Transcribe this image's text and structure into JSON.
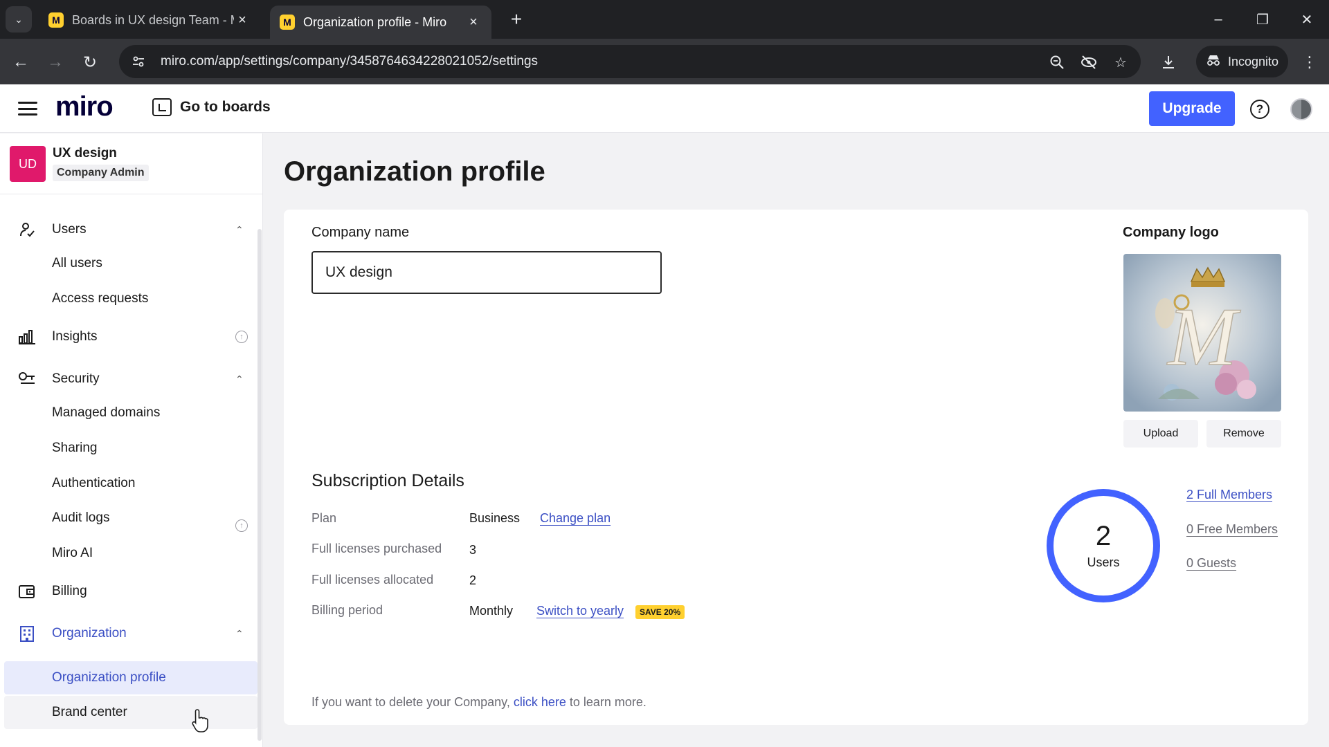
{
  "browser": {
    "tabs": [
      {
        "title": "Boards in UX design Team - Miro",
        "favicon": "miro-favicon"
      },
      {
        "title": "Organization profile - Miro",
        "favicon": "miro-favicon"
      }
    ],
    "url": "miro.com/app/settings/company/3458764634228021052/settings",
    "incognito_label": "Incognito",
    "favicon_letter": "M"
  },
  "header": {
    "logo": "miro",
    "go_to_boards": "Go to boards",
    "upgrade": "Upgrade",
    "help_symbol": "?"
  },
  "sidebar": {
    "org_initials": "UD",
    "org_name": "UX design",
    "org_role": "Company Admin",
    "users": {
      "label": "Users",
      "items": [
        "All users",
        "Access requests"
      ]
    },
    "insights": {
      "label": "Insights"
    },
    "security": {
      "label": "Security",
      "items": [
        "Managed domains",
        "Sharing",
        "Authentication",
        "Audit logs",
        "Miro AI"
      ]
    },
    "billing": {
      "label": "Billing"
    },
    "organization": {
      "label": "Organization",
      "items": [
        "Organization profile",
        "Brand center"
      ]
    }
  },
  "main": {
    "title": "Organization profile",
    "company_name_label": "Company name",
    "company_name_value": "UX design",
    "company_logo_label": "Company logo",
    "logo_letter": "M",
    "upload": "Upload",
    "remove": "Remove",
    "subscription": {
      "title": "Subscription Details",
      "plan_label": "Plan",
      "plan_value": "Business",
      "change_plan": "Change plan",
      "purchased_label": "Full licenses purchased",
      "purchased_value": "3",
      "allocated_label": "Full licenses allocated",
      "allocated_value": "2",
      "period_label": "Billing period",
      "period_value": "Monthly",
      "switch_yearly": "Switch to yearly",
      "save_badge": "SAVE 20%"
    },
    "users_summary": {
      "count": "2",
      "label": "Users",
      "full_members": "2 Full Members",
      "free_members": "0 Free Members",
      "guests": "0 Guests"
    },
    "delete_note": {
      "before": "If you want to delete your Company, ",
      "link": "click here",
      "after": " to learn more."
    }
  },
  "colors": {
    "accent": "#4262ff",
    "org_badge": "#e0196b",
    "badge_yellow": "#ffd02f"
  }
}
